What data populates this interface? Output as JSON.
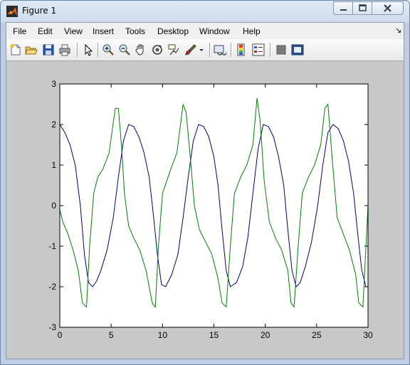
{
  "window": {
    "title": "Figure 1"
  },
  "menu": {
    "items": [
      "File",
      "Edit",
      "View",
      "Insert",
      "Tools",
      "Desktop",
      "Window",
      "Help"
    ],
    "arrow": "↘"
  },
  "toolbar": {
    "icons": [
      "new-figure-icon",
      "open-file-icon",
      "save-icon",
      "print-icon",
      "edit-plot-arrow-icon",
      "zoom-in-icon",
      "zoom-out-icon",
      "pan-hand-icon",
      "rotate-3d-icon",
      "data-cursor-icon",
      "brush-icon",
      "brush-menu-arrow-icon",
      "link-plot-icon",
      "insert-colorbar-icon",
      "insert-legend-icon",
      "hide-plot-tools-icon",
      "show-plot-tools-icon"
    ]
  },
  "colors": {
    "series1": "#00007f",
    "series2": "#007f00",
    "figure_bg": "#c8c8c8"
  },
  "chart_data": {
    "type": "line",
    "xlim": [
      0,
      30
    ],
    "ylim": [
      -3,
      3
    ],
    "xticks": [
      0,
      5,
      10,
      15,
      20,
      25,
      30
    ],
    "yticks": [
      -3,
      -2,
      -1,
      0,
      1,
      2,
      3
    ],
    "grid": false,
    "series": [
      {
        "color": "#00007f",
        "x": [
          0,
          0.5,
          1.0,
          1.5,
          2.0,
          2.4,
          2.8,
          3.2,
          3.6,
          4.0,
          4.6,
          5.2,
          5.7,
          6.2,
          6.7,
          7.2,
          7.7,
          8.2,
          8.7,
          9.1,
          9.5,
          9.9,
          10.3,
          10.9,
          11.5,
          12.0,
          12.5,
          13.0,
          13.5,
          14.0,
          14.5,
          15.0,
          15.4,
          15.8,
          16.2,
          16.6,
          17.2,
          17.8,
          18.3,
          18.8,
          19.3,
          19.8,
          20.3,
          20.8,
          21.3,
          21.8,
          22.2,
          22.6,
          23.0,
          23.4,
          23.9,
          24.5,
          25.1,
          25.6,
          26.1,
          26.6,
          27.1,
          27.6,
          28.1,
          28.6,
          29.0,
          29.4,
          29.8,
          30.0
        ],
        "y": [
          2.0,
          1.8,
          1.5,
          1.0,
          0.0,
          -1.2,
          -1.9,
          -2.0,
          -1.85,
          -1.6,
          -1.1,
          -0.3,
          0.7,
          1.6,
          2.0,
          1.95,
          1.7,
          1.3,
          0.7,
          -0.2,
          -1.2,
          -1.95,
          -2.0,
          -1.7,
          -1.2,
          -0.3,
          0.7,
          1.6,
          2.0,
          1.95,
          1.7,
          1.2,
          0.5,
          -0.6,
          -1.6,
          -2.0,
          -1.9,
          -1.5,
          -0.8,
          0.3,
          1.4,
          2.0,
          1.95,
          1.7,
          1.2,
          0.5,
          -0.6,
          -1.6,
          -2.0,
          -1.9,
          -1.5,
          -0.9,
          0.0,
          1.0,
          1.8,
          2.0,
          1.9,
          1.6,
          1.1,
          0.3,
          -0.7,
          -1.6,
          -2.0,
          -2.0
        ]
      },
      {
        "color": "#007f00",
        "x": [
          0,
          0.3,
          0.8,
          1.3,
          1.8,
          2.2,
          2.6,
          2.9,
          3.3,
          3.7,
          4.2,
          4.8,
          5.4,
          5.7,
          6.0,
          6.3,
          6.7,
          7.2,
          7.8,
          8.4,
          9.0,
          9.3,
          9.6,
          10.0,
          10.4,
          10.8,
          11.4,
          12.0,
          12.3,
          12.7,
          13.1,
          13.6,
          14.2,
          14.8,
          15.4,
          15.8,
          16.2,
          16.6,
          17.0,
          17.6,
          18.2,
          18.8,
          19.2,
          19.5,
          19.9,
          20.4,
          21.0,
          21.6,
          22.2,
          22.5,
          22.8,
          23.2,
          23.6,
          24.2,
          24.8,
          25.4,
          25.8,
          26.1,
          26.5,
          27.0,
          27.6,
          28.2,
          28.8,
          29.1,
          29.5,
          30.0
        ],
        "y": [
          -0.1,
          -0.4,
          -0.7,
          -1.1,
          -1.6,
          -2.4,
          -2.5,
          -1.0,
          0.3,
          0.7,
          0.9,
          1.3,
          2.4,
          2.4,
          1.5,
          0.3,
          -0.5,
          -0.8,
          -1.1,
          -1.6,
          -2.4,
          -2.5,
          -1.0,
          0.3,
          0.6,
          0.9,
          1.3,
          2.5,
          2.3,
          1.2,
          0.0,
          -0.6,
          -0.9,
          -1.2,
          -1.8,
          -2.4,
          -2.5,
          -1.0,
          0.3,
          0.7,
          1.0,
          1.5,
          2.65,
          2.1,
          0.6,
          -0.4,
          -0.8,
          -1.1,
          -1.6,
          -2.4,
          -2.5,
          -1.0,
          0.3,
          0.7,
          1.0,
          1.5,
          2.4,
          2.5,
          1.2,
          -0.3,
          -0.7,
          -1.1,
          -1.7,
          -2.4,
          -2.5,
          0.0
        ]
      }
    ]
  }
}
